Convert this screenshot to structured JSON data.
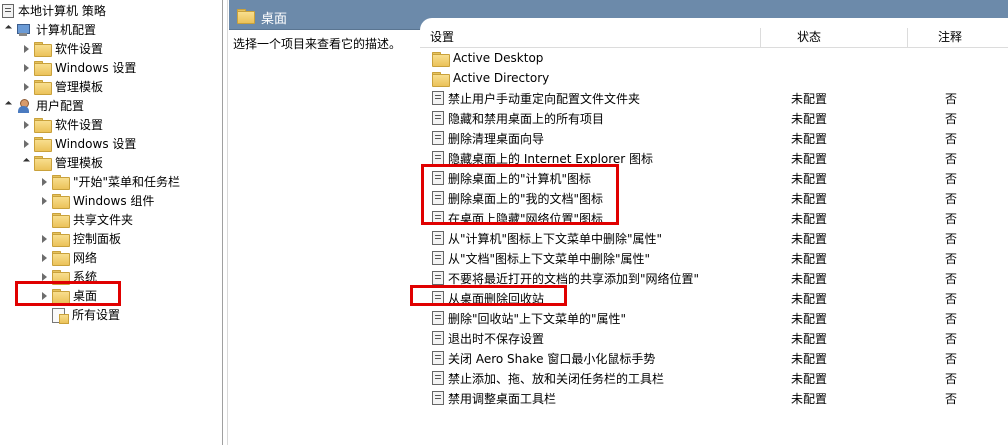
{
  "tree": {
    "root": "本地计算机 策略",
    "computer_config": "计算机配置",
    "cc_software": "软件设置",
    "cc_windows": "Windows 设置",
    "cc_admin": "管理模板",
    "user_config": "用户配置",
    "uc_software": "软件设置",
    "uc_windows": "Windows 设置",
    "uc_admin": "管理模板",
    "admin_children": [
      "\"开始\"菜单和任务栏",
      "Windows 组件",
      "共享文件夹",
      "控制面板",
      "网络",
      "系统",
      "桌面",
      "所有设置"
    ]
  },
  "header": {
    "title": "桌面"
  },
  "description": {
    "text": "选择一个项目来查看它的描述。"
  },
  "columns": {
    "setting": "设置",
    "state": "状态",
    "comment": "注释"
  },
  "rows": [
    {
      "name": "Active Desktop",
      "state": "",
      "comment": "",
      "type": "folder"
    },
    {
      "name": "Active Directory",
      "state": "",
      "comment": "",
      "type": "folder"
    },
    {
      "name": "禁止用户手动重定向配置文件文件夹",
      "state": "未配置",
      "comment": "否",
      "type": "policy"
    },
    {
      "name": "隐藏和禁用桌面上的所有项目",
      "state": "未配置",
      "comment": "否",
      "type": "policy"
    },
    {
      "name": "删除清理桌面向导",
      "state": "未配置",
      "comment": "否",
      "type": "policy"
    },
    {
      "name": "隐藏桌面上的 Internet Explorer 图标",
      "state": "未配置",
      "comment": "否",
      "type": "policy"
    },
    {
      "name": "删除桌面上的\"计算机\"图标",
      "state": "未配置",
      "comment": "否",
      "type": "policy"
    },
    {
      "name": "删除桌面上的\"我的文档\"图标",
      "state": "未配置",
      "comment": "否",
      "type": "policy"
    },
    {
      "name": "在桌面上隐藏\"网络位置\"图标",
      "state": "未配置",
      "comment": "否",
      "type": "policy"
    },
    {
      "name": "从\"计算机\"图标上下文菜单中删除\"属性\"",
      "state": "未配置",
      "comment": "否",
      "type": "policy"
    },
    {
      "name": "从\"文档\"图标上下文菜单中删除\"属性\"",
      "state": "未配置",
      "comment": "否",
      "type": "policy"
    },
    {
      "name": "不要将最近打开的文档的共享添加到\"网络位置\"",
      "state": "未配置",
      "comment": "否",
      "type": "policy"
    },
    {
      "name": "从桌面删除回收站",
      "state": "未配置",
      "comment": "否",
      "type": "policy"
    },
    {
      "name": "删除\"回收站\"上下文菜单的\"属性\"",
      "state": "未配置",
      "comment": "否",
      "type": "policy"
    },
    {
      "name": "退出时不保存设置",
      "state": "未配置",
      "comment": "否",
      "type": "policy"
    },
    {
      "name": "关闭 Aero Shake 窗口最小化鼠标手势",
      "state": "未配置",
      "comment": "否",
      "type": "policy"
    },
    {
      "name": "禁止添加、拖、放和关闭任务栏的工具栏",
      "state": "未配置",
      "comment": "否",
      "type": "policy"
    },
    {
      "name": "禁用调整桌面工具栏",
      "state": "未配置",
      "comment": "否",
      "type": "policy"
    }
  ],
  "colors": {
    "header_bar": "#6c8aaa",
    "annotation": "#e00000"
  }
}
